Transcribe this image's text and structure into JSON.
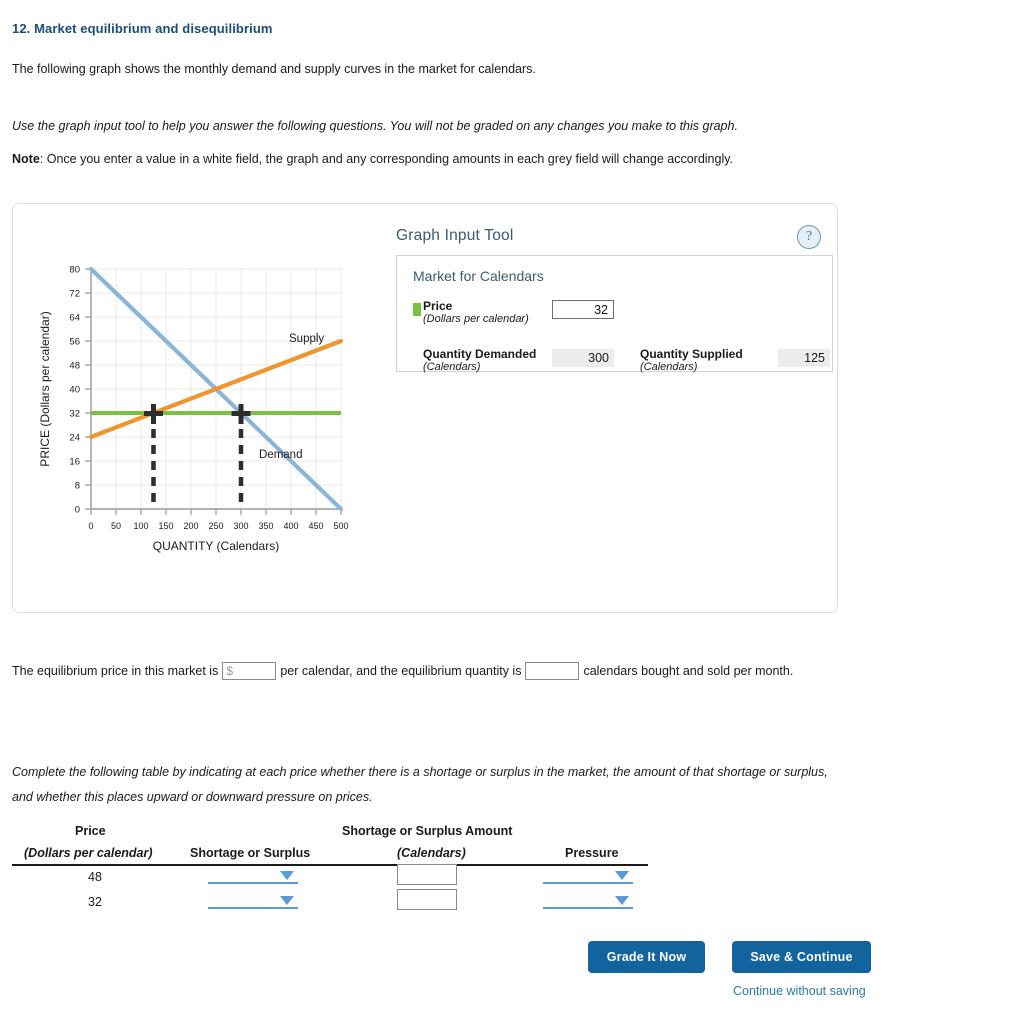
{
  "question": {
    "title": "12. Market equilibrium and disequilibrium",
    "intro": "The following graph shows the monthly demand and supply curves in the market for calendars.",
    "instruction": "Use the graph input tool to help you answer the following questions. You will not be graded on any changes you make to this graph.",
    "note_label": "Note",
    "note_text": ": Once you enter a value in a white field, the graph and any corresponding amounts in each grey field will change accordingly."
  },
  "graph_input_tool": {
    "title": "Graph Input Tool",
    "help_icon": "?",
    "market_title": "Market for Calendars",
    "price": {
      "label": "Price",
      "units": "(Dollars per calendar)",
      "value": "32",
      "swatch_color": "#7cc242"
    },
    "quantity_demanded": {
      "label": "Quantity Demanded",
      "units": "(Calendars)",
      "value": "300"
    },
    "quantity_supplied": {
      "label": "Quantity Supplied",
      "units": "(Calendars)",
      "value": "125"
    }
  },
  "chart_data": {
    "type": "line",
    "title": "",
    "xlabel": "QUANTITY (Calendars)",
    "ylabel": "PRICE (Dollars per calendar)",
    "xlim": [
      0,
      500
    ],
    "ylim": [
      0,
      80
    ],
    "xticks": [
      0,
      50,
      100,
      150,
      200,
      250,
      300,
      350,
      400,
      450,
      500
    ],
    "yticks": [
      0,
      8,
      16,
      24,
      32,
      40,
      48,
      56,
      64,
      72,
      80
    ],
    "grid": true,
    "legend_position": "inline-labels",
    "series": [
      {
        "name": "Demand",
        "color": "#8ab4d8",
        "points": [
          [
            0,
            80
          ],
          [
            500,
            0
          ]
        ],
        "label": "Demand",
        "label_at": [
          330,
          22
        ]
      },
      {
        "name": "Supply",
        "color": "#f0942e",
        "points": [
          [
            0,
            24
          ],
          [
            500,
            56
          ]
        ],
        "label": "Supply",
        "label_at": [
          390,
          58
        ]
      },
      {
        "name": "Price Line",
        "color": "#7cc242",
        "points": [
          [
            0,
            32
          ],
          [
            500,
            32
          ]
        ],
        "label": "",
        "label_at": null
      }
    ],
    "markers": [
      {
        "name": "quantity-supplied-marker",
        "x": 125,
        "y": 32,
        "color": "#2d2d2d"
      },
      {
        "name": "quantity-demanded-marker",
        "x": 300,
        "y": 32,
        "color": "#2d2d2d"
      }
    ],
    "equilibrium": {
      "x": 250,
      "y": 40
    },
    "annotations": [
      "Supply",
      "Demand"
    ]
  },
  "equilibrium_sentence": {
    "part1": "The equilibrium price in this market is",
    "price_prefix": "$",
    "price_value": "",
    "part2": "per calendar, and the equilibrium quantity is",
    "quantity_value": "",
    "part3": "calendars bought and sold per month."
  },
  "table_intro": {
    "line1": "Complete the following table by indicating at each price whether there is a shortage or surplus in the market, the amount of that shortage or surplus,",
    "line2": "and whether this places upward or downward pressure on prices."
  },
  "table": {
    "headers": {
      "price": "Price",
      "price_units": "(Dollars per calendar)",
      "shortage_or_surplus": "Shortage or Surplus",
      "amount": "Shortage or Surplus Amount",
      "amount_units": "(Calendars)",
      "pressure": "Pressure"
    },
    "rows": [
      {
        "price": "48",
        "shortage_or_surplus": "",
        "amount": "",
        "pressure": ""
      },
      {
        "price": "32",
        "shortage_or_surplus": "",
        "amount": "",
        "pressure": ""
      }
    ]
  },
  "footer": {
    "grade_label": "Grade It Now",
    "save_label": "Save & Continue",
    "continue_link": "Continue without saving"
  }
}
